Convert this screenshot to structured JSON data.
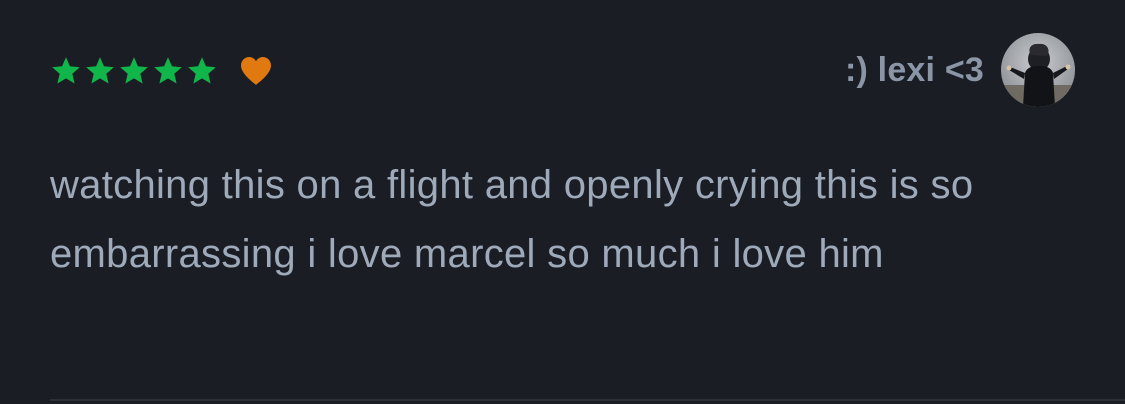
{
  "colors": {
    "background": "#1b1d24",
    "star": "#10b64a",
    "heart": "#e07a10",
    "author_text": "#8a96a6",
    "body_text": "#9eaab9",
    "divider": "#2c3037"
  },
  "review": {
    "rating": {
      "stars": 5,
      "max_stars": 5,
      "liked": true,
      "star_icon": "star-icon",
      "heart_icon": "heart-icon"
    },
    "author": {
      "name": ":) lexi <3",
      "avatar_icon": "avatar-photo"
    },
    "text": "watching this on a flight and openly crying this is so embarrassing i love marcel so much i love him"
  }
}
